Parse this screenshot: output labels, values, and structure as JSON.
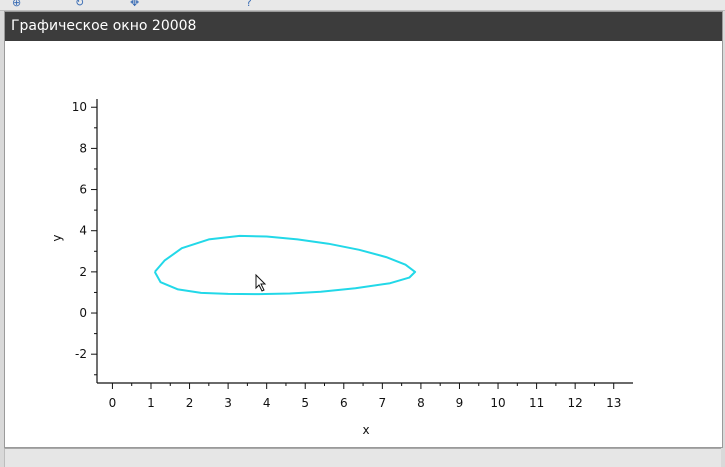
{
  "window": {
    "title": "Графическое окно 20008"
  },
  "icons": {
    "toolbar": [
      "zoom-icon",
      "rotate-icon",
      "pan-icon",
      "help-icon"
    ],
    "cursor": "arrow-cursor-icon"
  },
  "chart_data": {
    "type": "line",
    "xlabel": "x",
    "ylabel": "y",
    "xlim": [
      -0.4,
      13.5
    ],
    "ylim": [
      -3.4,
      10.4
    ],
    "xticks": [
      0,
      1,
      2,
      3,
      4,
      5,
      6,
      7,
      8,
      9,
      10,
      11,
      12,
      13
    ],
    "yticks": [
      -2,
      0,
      2,
      4,
      6,
      8,
      10
    ],
    "grid": false,
    "series": [
      {
        "color": "#22d8e8",
        "x": [
          1.1,
          1.35,
          1.8,
          2.5,
          3.3,
          4.0,
          4.8,
          5.6,
          6.4,
          7.1,
          7.6,
          7.85,
          7.7,
          7.2,
          6.3,
          5.4,
          4.6,
          3.8,
          3.0,
          2.3,
          1.7,
          1.25,
          1.1
        ],
        "y": [
          2.0,
          2.55,
          3.15,
          3.58,
          3.75,
          3.72,
          3.58,
          3.37,
          3.07,
          2.72,
          2.35,
          2.0,
          1.72,
          1.45,
          1.2,
          1.03,
          0.95,
          0.92,
          0.93,
          0.98,
          1.15,
          1.5,
          2.0
        ]
      }
    ]
  }
}
